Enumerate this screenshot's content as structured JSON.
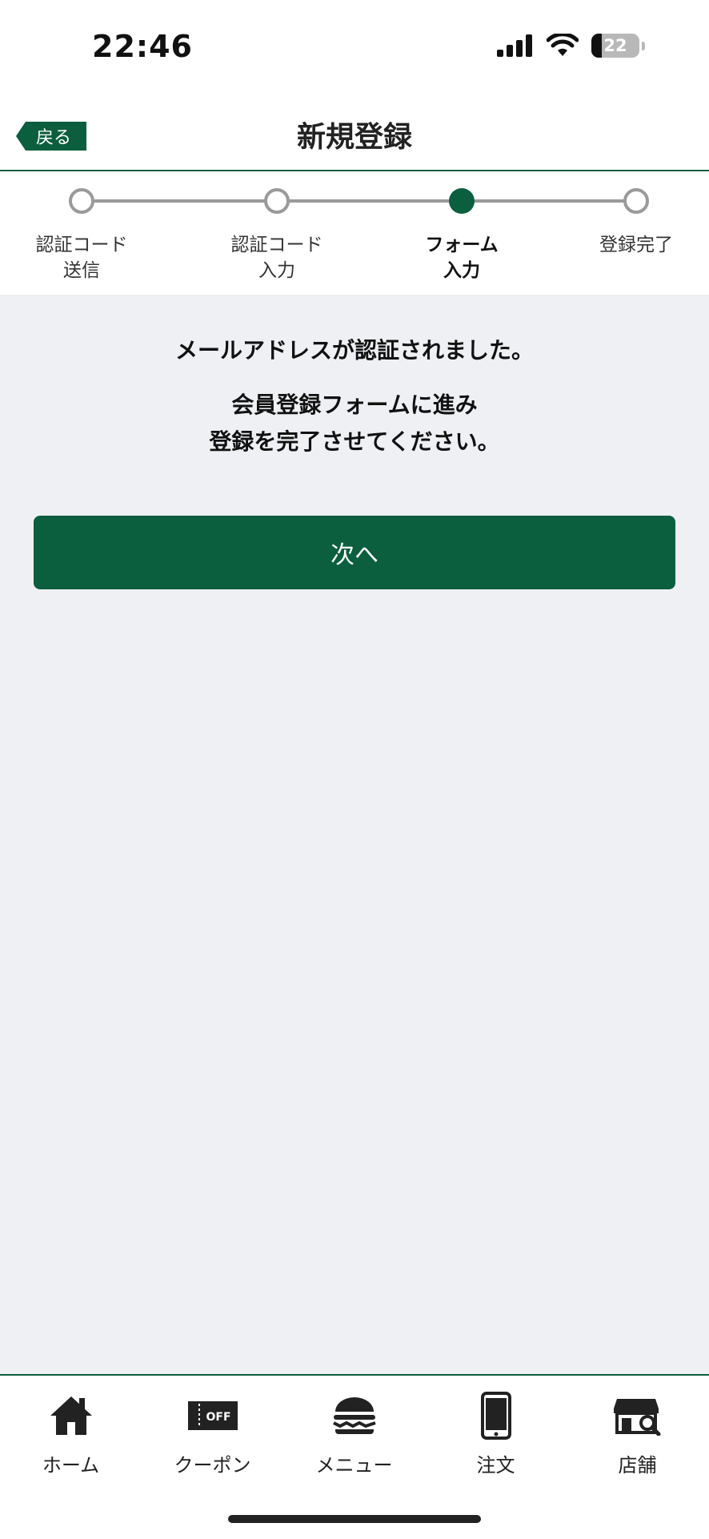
{
  "status_bar": {
    "time": "22:46",
    "battery_level": "22",
    "battery_fraction": 0.22
  },
  "header": {
    "back_label": "戻る",
    "title": "新規登録"
  },
  "stepper": {
    "current_step": 3,
    "steps": [
      {
        "line1": "認証コード",
        "line2": "送信"
      },
      {
        "line1": "認証コード",
        "line2": "入力"
      },
      {
        "line1": "フォーム",
        "line2": "入力"
      },
      {
        "line1": "登録完了",
        "line2": ""
      }
    ]
  },
  "content": {
    "verified_message": "メールアドレスが認証されました。",
    "instruction_line1": "会員登録フォームに進み",
    "instruction_line2": "登録を完了させてください。",
    "next_button_label": "次へ"
  },
  "tab_bar": {
    "items": [
      {
        "label": "ホーム",
        "icon": "home-icon"
      },
      {
        "label": "クーポン",
        "icon": "coupon-icon"
      },
      {
        "label": "メニュー",
        "icon": "burger-icon"
      },
      {
        "label": "注文",
        "icon": "phone-icon"
      },
      {
        "label": "店舗",
        "icon": "store-search-icon"
      }
    ]
  },
  "colors": {
    "brand_green": "#0b5e3e",
    "background": "#eef0f3",
    "inactive_gray": "#9a9a9a"
  }
}
